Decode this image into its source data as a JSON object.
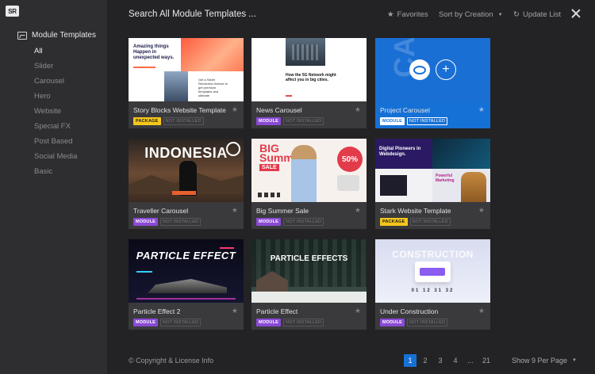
{
  "app": {
    "logo": "SR"
  },
  "sidebar": {
    "title": "Module Templates",
    "items": [
      {
        "label": "All",
        "active": true
      },
      {
        "label": "Slider"
      },
      {
        "label": "Carousel"
      },
      {
        "label": "Hero"
      },
      {
        "label": "Website"
      },
      {
        "label": "Special FX"
      },
      {
        "label": "Post Based"
      },
      {
        "label": "Social Media"
      },
      {
        "label": "Basic"
      }
    ]
  },
  "header": {
    "search_title": "Search All Module Templates ...",
    "favorites_label": "Favorites",
    "sort_label": "Sort by Creation",
    "update_label": "Update List"
  },
  "thumbs": {
    "story_text": "Amazing things Happen in unexpected ways.",
    "story_small": "Get a Slider Revolution license to get premium templates and ultimate",
    "news_text": "How the 5G Network might affect you in big cities.",
    "carousel_bg": "CAROUSEL",
    "indonesia": "INDONESIA",
    "big": "BIG",
    "summer": "Summer",
    "sale": "SALE",
    "pct": "50%",
    "stark_title": "Digital Pioneers in Webdesign.",
    "stark_power": "Powerful Marketing",
    "particle": "PARTICLE EFFECT",
    "particle2": "PARTICLE EFFECTS",
    "construction": "CONSTRUCTION",
    "countdown": "01 12 31 32"
  },
  "cards": [
    {
      "title": "Story Blocks Website Template",
      "type": "PACKAGE",
      "status": "NOT INSTALLED"
    },
    {
      "title": "News Carousel",
      "type": "MODULE",
      "status": "NOT INSTALLED"
    },
    {
      "title": "Project Carousel",
      "type": "MODULE",
      "status": "NOT INSTALLED",
      "selected": true
    },
    {
      "title": "Traveller Carousel",
      "type": "MODULE",
      "status": "NOT INSTALLED"
    },
    {
      "title": "Big Summer Sale",
      "type": "MODULE",
      "status": "NOT INSTALLED"
    },
    {
      "title": "Stark Website Template",
      "type": "PACKAGE",
      "status": "NOT INSTALLED"
    },
    {
      "title": "Particle Effect 2",
      "type": "MODULE",
      "status": "NOT INSTALLED"
    },
    {
      "title": "Particle Effect",
      "type": "MODULE",
      "status": "NOT INSTALLED"
    },
    {
      "title": "Under Construction",
      "type": "MODULE",
      "status": "NOT INSTALLED"
    }
  ],
  "footer": {
    "copyright": "© Copyright & License Info",
    "pages": [
      "1",
      "2",
      "3",
      "4",
      "...",
      "21"
    ],
    "current_page": "1",
    "per_page": "Show 9 Per Page"
  },
  "colors": {
    "accent": "#1671d6",
    "package_tag": "#f5c71a",
    "module_tag": "#8a4ad6"
  }
}
